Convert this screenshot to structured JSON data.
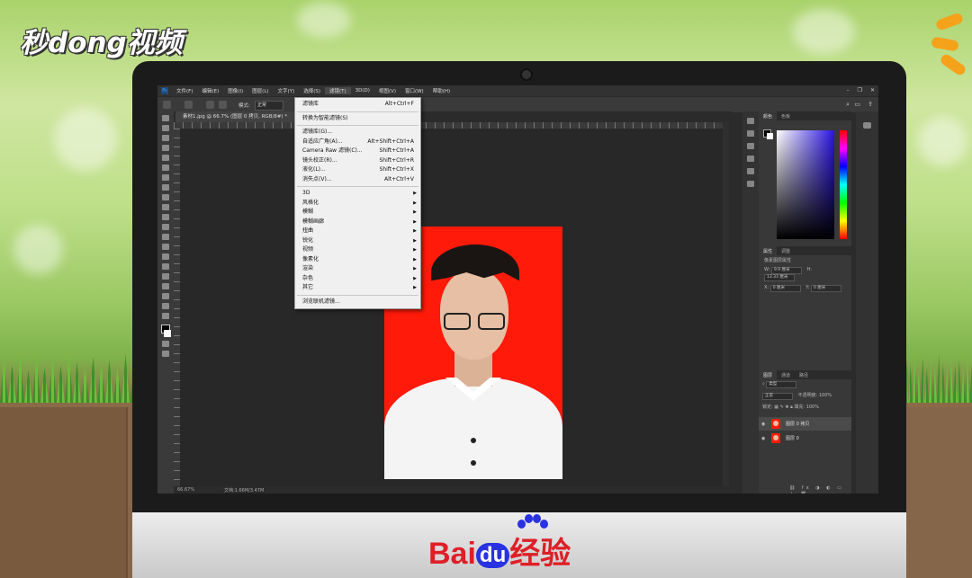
{
  "watermarks": {
    "top_left": "秒dong视频",
    "bottom": {
      "brand_left": "Bai",
      "brand_du": "du",
      "brand_right": "经验"
    }
  },
  "colors": {
    "photo_background": "#ff1a0a",
    "menu_background": "#f0f0f0",
    "ui_dark": "#2b2b2b",
    "accent_blue": "#2932e1"
  },
  "menubar": {
    "items": [
      "文件(F)",
      "编辑(E)",
      "图像(I)",
      "图层(L)",
      "文字(Y)",
      "选择(S)",
      "滤镜(T)",
      "3D(D)",
      "视图(V)",
      "窗口(W)",
      "帮助(H)"
    ],
    "active": "滤镜(T)"
  },
  "options_bar": {
    "mode_label": "模式:",
    "mode_value": "正常"
  },
  "document": {
    "tab": "素材1.jpg @ 66.7% (图层 0 拷贝, RGB/8#) *"
  },
  "status": {
    "zoom": "66.67%",
    "doc": "文档:1.66M/3.47M"
  },
  "filter_menu": {
    "items": [
      {
        "label": "滤镜库",
        "shortcut": "Alt+Ctrl+F"
      },
      {
        "sep": true
      },
      {
        "label": "转换为智能滤镜(S)"
      },
      {
        "sep": true
      },
      {
        "label": "滤镜库(G)..."
      },
      {
        "label": "自适应广角(A)...",
        "shortcut": "Alt+Shift+Ctrl+A"
      },
      {
        "label": "Camera Raw 滤镜(C)...",
        "shortcut": "Shift+Ctrl+A"
      },
      {
        "label": "镜头校正(R)...",
        "shortcut": "Shift+Ctrl+R"
      },
      {
        "label": "液化(L)...",
        "shortcut": "Shift+Ctrl+X"
      },
      {
        "label": "消失点(V)...",
        "shortcut": "Alt+Ctrl+V"
      },
      {
        "sep": true
      },
      {
        "label": "3D",
        "submenu": true
      },
      {
        "label": "风格化",
        "submenu": true
      },
      {
        "label": "模糊",
        "submenu": true
      },
      {
        "label": "模糊画廊",
        "submenu": true
      },
      {
        "label": "扭曲",
        "submenu": true
      },
      {
        "label": "锐化",
        "submenu": true
      },
      {
        "label": "视频",
        "submenu": true
      },
      {
        "label": "像素化",
        "submenu": true
      },
      {
        "label": "渲染",
        "submenu": true
      },
      {
        "label": "杂色",
        "submenu": true
      },
      {
        "label": "其它",
        "submenu": true
      },
      {
        "sep": true
      },
      {
        "label": "浏览联机滤镜..."
      }
    ]
  },
  "color_panel": {
    "tabs": [
      "颜色",
      "色板"
    ]
  },
  "properties_panel": {
    "tabs": [
      "属性",
      "调整"
    ],
    "title": "像素图层属性",
    "w_label": "W:",
    "w_value": "9.9 厘米",
    "h_label": "H:",
    "h_value": "13.33 厘米",
    "x_label": "X:",
    "x_value": "0 厘米",
    "y_label": "Y:",
    "y_value": "0 厘米"
  },
  "layers_panel": {
    "tabs": [
      "图层",
      "通道",
      "路径"
    ],
    "filter": "类型",
    "blend": "正常",
    "opacity_label": "不透明度:",
    "opacity_value": "100%",
    "lock_label": "锁定:",
    "fill_label": "填充:",
    "fill_value": "100%",
    "layers": [
      {
        "name": "图层 0 拷贝"
      },
      {
        "name": "图层 0"
      }
    ]
  }
}
